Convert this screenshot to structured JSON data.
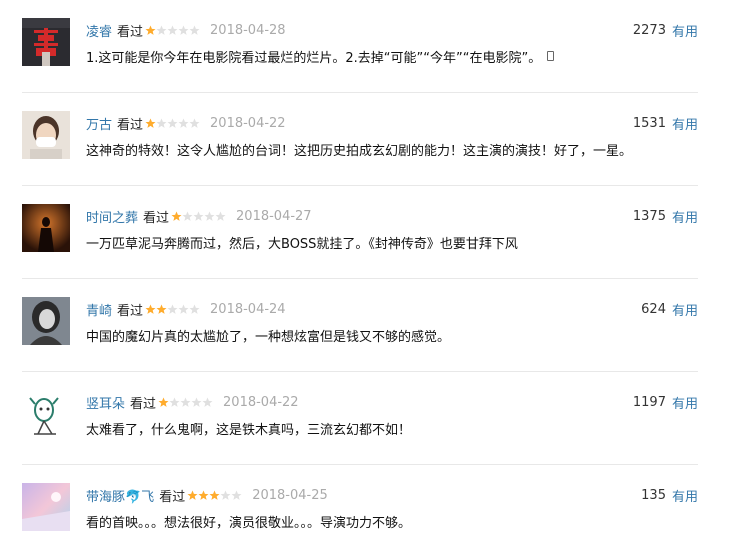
{
  "reviews": [
    {
      "user": "凌睿",
      "watched": "看过",
      "rating": 1,
      "date": "2018-04-28",
      "votes": "2273",
      "vote_label": "有用",
      "text": "1.这可能是你今年在电影院看过最烂的烂片。2.去掉“可能”“今年”“在电影院”。",
      "has_phone_icon": true,
      "avatar_icon": "red-double-happiness-avatar"
    },
    {
      "user": "万古",
      "watched": "看过",
      "rating": 1,
      "date": "2018-04-22",
      "votes": "1531",
      "vote_label": "有用",
      "text": "这神奇的特效！这令人尴尬的台词！这把历史拍成玄幻剧的能力！这主演的演技！好了，一星。",
      "has_phone_icon": false,
      "avatar_icon": "masked-person-avatar"
    },
    {
      "user": "时间之葬",
      "watched": "看过",
      "rating": 1,
      "date": "2018-04-27",
      "votes": "1375",
      "vote_label": "有用",
      "text": "一万匹草泥马奔腾而过，然后，大BOSS就挂了。《封神传奇》也要甘拜下风",
      "has_phone_icon": false,
      "avatar_icon": "dark-figure-avatar"
    },
    {
      "user": "青崎",
      "watched": "看过",
      "rating": 2,
      "date": "2018-04-24",
      "votes": "624",
      "vote_label": "有用",
      "text": "中国的魔幻片真的太尴尬了，一种想炫富但是钱又不够的感觉。",
      "has_phone_icon": false,
      "avatar_icon": "grayscale-portrait-avatar"
    },
    {
      "user": "竖耳朵",
      "watched": "看过",
      "rating": 1,
      "date": "2018-04-22",
      "votes": "1197",
      "vote_label": "有用",
      "text": "太难看了，什么鬼啊，这是铁木真吗，三流玄幻都不如！",
      "has_phone_icon": false,
      "avatar_icon": "sketch-bird-avatar"
    },
    {
      "user": "带海豚🐬飞",
      "watched": "看过",
      "rating": 3,
      "date": "2018-04-25",
      "votes": "135",
      "vote_label": "有用",
      "text": "看的首映。。。想法很好，演员很敬业。。。导演功力不够。",
      "has_phone_icon": false,
      "avatar_icon": "pastel-sky-avatar"
    }
  ],
  "colors": {
    "star_on": "#ffac2d",
    "star_off": "#e0e0e0",
    "link": "#3377aa",
    "date": "#aaaaaa"
  }
}
